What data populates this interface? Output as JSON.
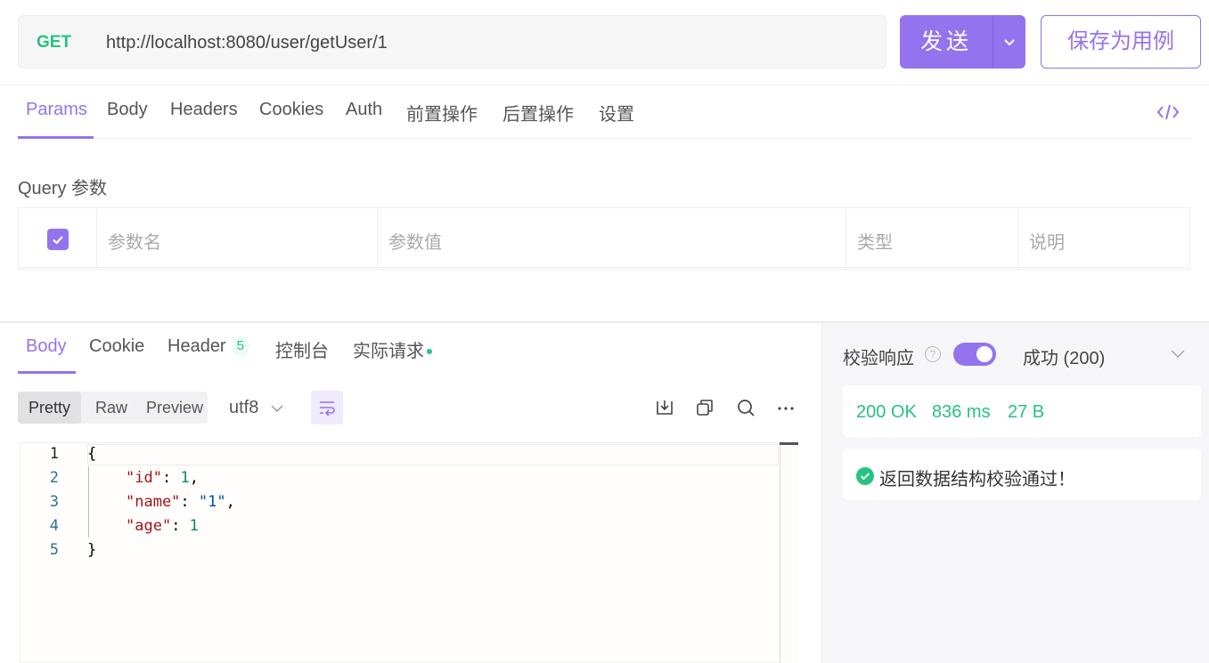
{
  "request": {
    "method": "GET",
    "url": "http://localhost:8080/user/getUser/1",
    "send_label": "发送",
    "save_label": "保存为用例"
  },
  "req_tabs": [
    "Params",
    "Body",
    "Headers",
    "Cookies",
    "Auth",
    "前置操作",
    "后置操作",
    "设置"
  ],
  "query": {
    "title": "Query 参数",
    "columns": [
      "参数名",
      "参数值",
      "类型",
      "说明"
    ]
  },
  "response": {
    "tabs": {
      "body": "Body",
      "cookie": "Cookie",
      "header": "Header",
      "header_count": "5",
      "console": "控制台",
      "actual": "实际请求"
    },
    "views": [
      "Pretty",
      "Raw",
      "Preview"
    ],
    "encoding": "utf8",
    "code": {
      "line_numbers": [
        "1",
        "2",
        "3",
        "4",
        "5"
      ],
      "open_brace": "{",
      "close_brace": "}",
      "fields": [
        {
          "key": "\"id\"",
          "value": "1",
          "trail": ","
        },
        {
          "key": "\"name\"",
          "value": "\"1\"",
          "trail": ","
        },
        {
          "key": "\"age\"",
          "value": "1",
          "trail": ""
        }
      ]
    }
  },
  "validation": {
    "label": "校验响应",
    "status": "成功 (200)",
    "stats": [
      "200 OK",
      "836 ms",
      "27 B"
    ],
    "result": "返回数据结构校验通过！"
  },
  "colors": {
    "accent": "#9373ee",
    "success": "#26c281"
  }
}
